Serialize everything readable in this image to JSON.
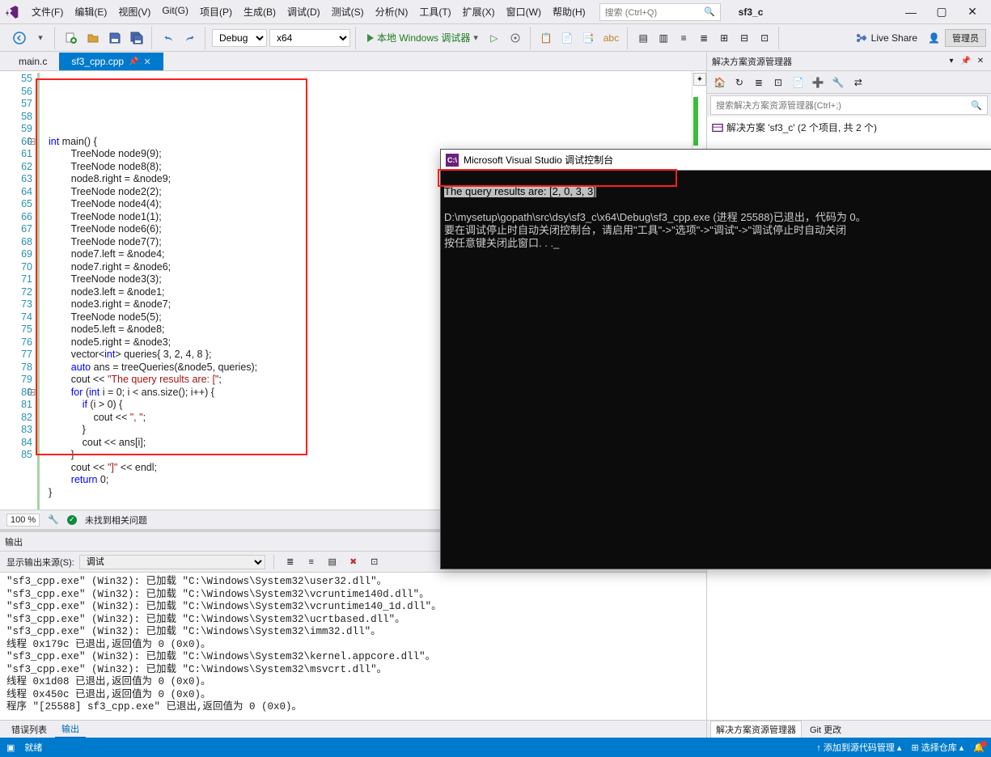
{
  "menu": [
    "文件(F)",
    "编辑(E)",
    "视图(V)",
    "Git(G)",
    "项目(P)",
    "生成(B)",
    "调试(D)",
    "测试(S)",
    "分析(N)",
    "工具(T)",
    "扩展(X)",
    "窗口(W)",
    "帮助(H)"
  ],
  "search_placeholder": "搜索 (Ctrl+Q)",
  "solution_name": "sf3_c",
  "toolbar": {
    "config": "Debug",
    "platform": "x64",
    "run_label": "本地 Windows 调试器",
    "liveshare": "Live Share",
    "admin": "管理员"
  },
  "tabs": {
    "inactive": "main.c",
    "active": "sf3_cpp.cpp"
  },
  "line_numbers": [
    "55",
    "56",
    "57",
    "58",
    "59",
    "60",
    "61",
    "62",
    "63",
    "64",
    "65",
    "66",
    "67",
    "68",
    "69",
    "70",
    "71",
    "72",
    "73",
    "74",
    "75",
    "76",
    "77",
    "78",
    "79",
    "80",
    "81",
    "82",
    "83",
    "84",
    "85"
  ],
  "code_lines": [
    {
      "t": ""
    },
    {
      "t": "int main() {",
      "hl": [
        [
          "int",
          "kw"
        ]
      ],
      "fold": "⊟"
    },
    {
      "t": "        TreeNode node9(9);"
    },
    {
      "t": "        TreeNode node8(8);"
    },
    {
      "t": "        node8.right = &node9;"
    },
    {
      "t": "        TreeNode node2(2);"
    },
    {
      "t": "        TreeNode node4(4);"
    },
    {
      "t": "        TreeNode node1(1);"
    },
    {
      "t": "        TreeNode node6(6);"
    },
    {
      "t": "        TreeNode node7(7);"
    },
    {
      "t": "        node7.left = &node4;"
    },
    {
      "t": "        node7.right = &node6;"
    },
    {
      "t": "        TreeNode node3(3);"
    },
    {
      "t": "        node3.left = &node1;"
    },
    {
      "t": "        node3.right = &node7;"
    },
    {
      "t": "        TreeNode node5(5);"
    },
    {
      "t": "        node5.left = &node8;"
    },
    {
      "t": "        node5.right = &node3;"
    },
    {
      "t": "        vector<int> queries{ 3, 2, 4, 8 };",
      "hl": [
        [
          "int",
          "kw"
        ]
      ]
    },
    {
      "t": "        auto ans = treeQueries(&node5, queries);",
      "hl": [
        [
          "auto",
          "kw"
        ]
      ]
    },
    {
      "t": "        cout << \"The query results are: [\";",
      "hl": [
        [
          "\"The query results are: [\"",
          "str"
        ]
      ]
    },
    {
      "t": "        for (int i = 0; i < ans.size(); i++) {",
      "hl": [
        [
          "for",
          "kw"
        ],
        [
          "int",
          "kw"
        ]
      ],
      "fold": "⊟"
    },
    {
      "t": "            if (i > 0) {",
      "hl": [
        [
          "if",
          "kw"
        ]
      ]
    },
    {
      "t": "                cout << \", \";",
      "hl": [
        [
          "\", \"",
          "str"
        ]
      ]
    },
    {
      "t": "            }"
    },
    {
      "t": "            cout << ans[i];"
    },
    {
      "t": "        }"
    },
    {
      "t": "        cout << \"]\" << endl;",
      "hl": [
        [
          "\"]\"",
          "str"
        ]
      ]
    },
    {
      "t": "        return 0;",
      "hl": [
        [
          "return",
          "kw"
        ]
      ]
    },
    {
      "t": "}"
    },
    {
      "t": ""
    }
  ],
  "editor_status": {
    "zoom": "100 %",
    "issues": "未找到相关问题"
  },
  "output": {
    "title": "输出",
    "source_label": "显示输出来源(S):",
    "source_value": "调试",
    "body": "\"sf3_cpp.exe\" (Win32): 已加载 \"C:\\Windows\\System32\\user32.dll\"。\n\"sf3_cpp.exe\" (Win32): 已加载 \"C:\\Windows\\System32\\vcruntime140d.dll\"。\n\"sf3_cpp.exe\" (Win32): 已加载 \"C:\\Windows\\System32\\vcruntime140_1d.dll\"。\n\"sf3_cpp.exe\" (Win32): 已加载 \"C:\\Windows\\System32\\ucrtbased.dll\"。\n\"sf3_cpp.exe\" (Win32): 已加载 \"C:\\Windows\\System32\\imm32.dll\"。\n线程 0x179c 已退出,返回值为 0 (0x0)。\n\"sf3_cpp.exe\" (Win32): 已加载 \"C:\\Windows\\System32\\kernel.appcore.dll\"。\n\"sf3_cpp.exe\" (Win32): 已加载 \"C:\\Windows\\System32\\msvcrt.dll\"。\n线程 0x1d08 已退出,返回值为 0 (0x0)。\n线程 0x450c 已退出,返回值为 0 (0x0)。\n程序 \"[25588] sf3_cpp.exe\" 已退出,返回值为 0 (0x0)。",
    "tab_errlist": "错误列表",
    "tab_output": "输出"
  },
  "solution_panel": {
    "title": "解决方案资源管理器",
    "search_placeholder": "搜索解决方案资源管理器(Ctrl+;)",
    "root": "解决方案 'sf3_c' (2 个项目, 共 2 个)",
    "tabs": [
      "解决方案资源管理器",
      "Git 更改"
    ]
  },
  "statusbar": {
    "ready": "就绪",
    "source_control": "添加到源代码管理",
    "repo": "选择仓库"
  },
  "console": {
    "title": "Microsoft Visual Studio 调试控制台",
    "line1": "The query results are: [2, 0, 3, 3]",
    "line3a": "D:\\mysetup\\gopath\\src\\dsy\\sf3_c\\x64\\Debug\\sf3_cpp.exe (进程 25588)已退出，代码为 0。",
    "line3b": "要在调试停止时自动关闭控制台，请启用\"工具\"->\"选项\"->\"调试\"->\"调试停止时自动关闭",
    "line3c": "按任意键关闭此窗口. . ._"
  }
}
